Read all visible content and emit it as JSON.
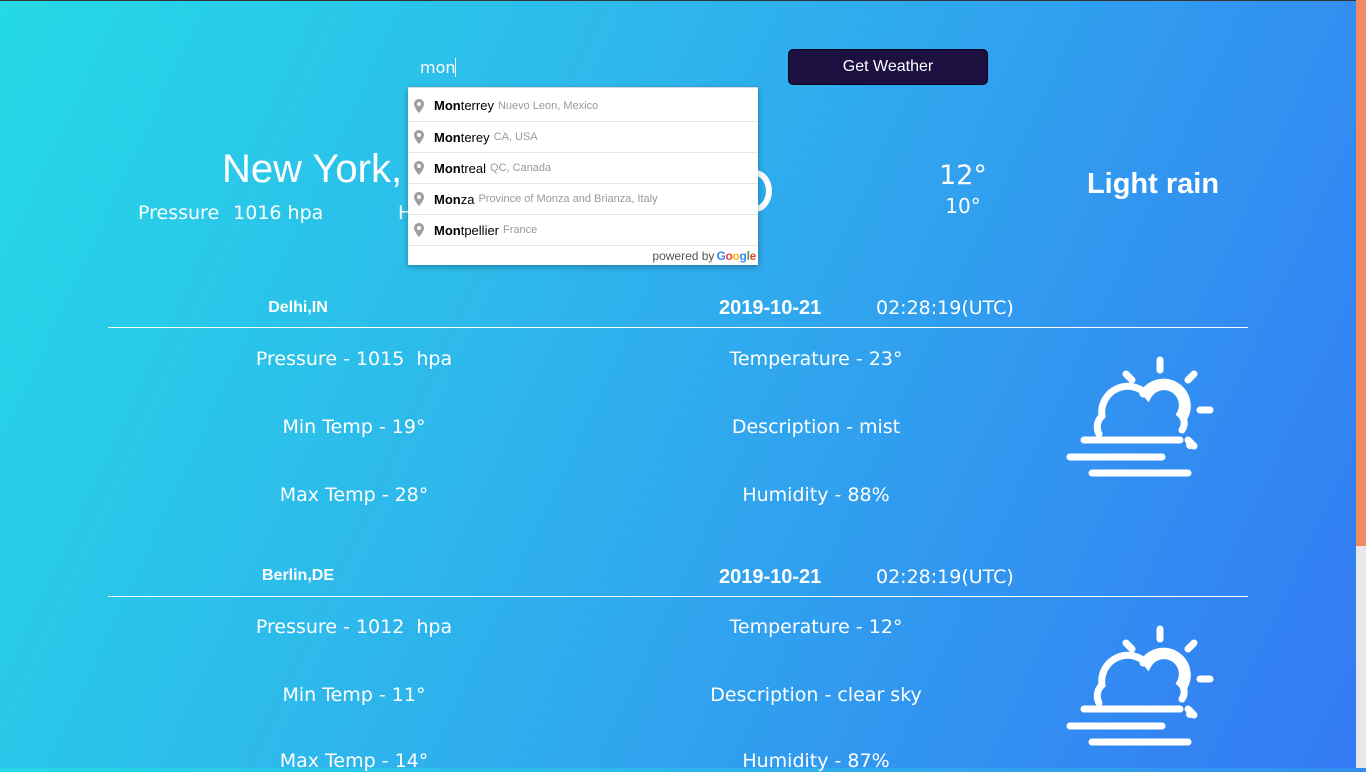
{
  "search": {
    "value": "mon",
    "button_label": "Get Weather"
  },
  "current": {
    "city": "New York,",
    "pressure_label": "Pressure",
    "pressure_value": "1016 hpa",
    "humidity_label_partial": "H",
    "temp": "12°",
    "temp_min": "10°",
    "description": "Light rain"
  },
  "autocomplete": {
    "items": [
      {
        "match": "Mon",
        "rest": "terrey",
        "secondary": "Nuevo Leon, Mexico"
      },
      {
        "match": "Mon",
        "rest": "terey",
        "secondary": "CA, USA"
      },
      {
        "match": "Mon",
        "rest": "treal",
        "secondary": "QC, Canada"
      },
      {
        "match": "Mon",
        "rest": "za",
        "secondary": "Province of Monza and Brianza, Italy"
      },
      {
        "match": "Mon",
        "rest": "tpellier",
        "secondary": "France"
      }
    ],
    "powered_by": "powered by",
    "google": "Google",
    "google_colors": [
      "#4285F4",
      "#EA4335",
      "#FBBC05",
      "#4285F4",
      "#34A853",
      "#EA4335"
    ]
  },
  "cards": [
    {
      "city": "Delhi,IN",
      "date": "2019-10-21",
      "time": "02:28:19(UTC)",
      "pressure": "Pressure - 1015  hpa",
      "temperature": "Temperature - 23°",
      "min_temp": "Min Temp - 19°",
      "description": "Description - mist",
      "max_temp": "Max Temp - 28°",
      "humidity": "Humidity - 88%",
      "icon": "fog-partly-cloudy-icon"
    },
    {
      "city": "Berlin,DE",
      "date": "2019-10-21",
      "time": "02:28:19(UTC)",
      "pressure": "Pressure - 1012  hpa",
      "temperature": "Temperature - 12°",
      "min_temp": "Min Temp - 11°",
      "description": "Description - clear sky",
      "max_temp": "Max Temp - 14°",
      "humidity": "Humidity - 87%",
      "icon": "fog-partly-cloudy-icon"
    }
  ],
  "colors": {
    "bg_start": "#25d9e6",
    "bg_end": "#3479f4",
    "button": "#1b1040",
    "scroll_thumb": "#f08a62"
  }
}
